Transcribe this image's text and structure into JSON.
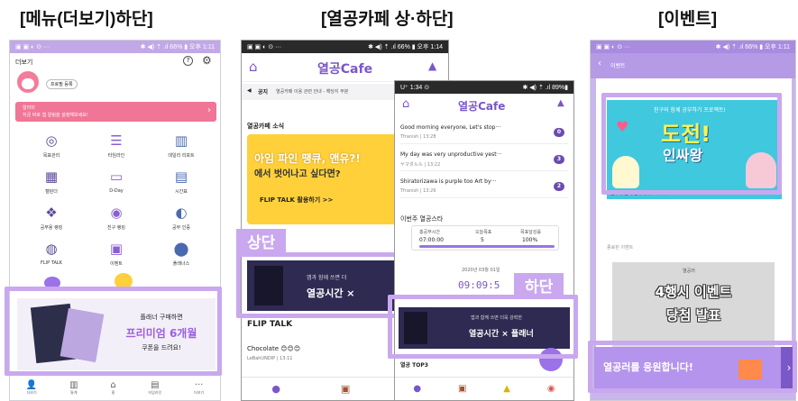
{
  "titles": [
    "[메뉴(더보기)하단]",
    "[열공카페 상·하단]",
    "[이벤트]"
  ],
  "tags": {
    "top": "상단",
    "bottom": "하단"
  },
  "p1": {
    "status_left": "▣ ▣ ◐ ⊙ ···",
    "status_right": "✱ ◀) ⇡ .ıl 66% ▮ 오후 1:11",
    "header": "더보기",
    "profile_btn": "프로필 등록",
    "notice_title": "알리미",
    "notice_text": "지금 바로 앱 알림을 설정해보세요!",
    "grid": [
      [
        "목표관리",
        "타임라인",
        "데일리 리포트"
      ],
      [
        "캘린더",
        "D-Day",
        "시간표"
      ],
      [
        "공부용 랭킹",
        "친구 랭킹",
        "공부 인증"
      ],
      [
        "FLIP TALK",
        "이벤트",
        "플래너스"
      ]
    ],
    "banner": [
      "플래너 구매하면",
      "프리미엄 6개월",
      "쿠폰을 드려요!"
    ],
    "nav": [
      "더보기",
      "통계",
      "홈",
      "타임라인",
      "더보기"
    ]
  },
  "p2": {
    "status_left": "▣ ▣ ◐ ⊙ ···",
    "status_right": "✱ ◀) ⇡ .ıl 66% ▮ 오후 1:14",
    "logo": "열공Cafe",
    "notice_label": "공지",
    "notice_text": "열공카페 이용 관련 안내 - 해당지 부분",
    "section": "열공카페 소식",
    "hero": [
      "아임 파인 땡큐, 앤유?!",
      "에서 벗어나고 싶다면?"
    ],
    "hero_link": "FLIP TALK 활용하기 >>",
    "ad": [
      "앱과 함께 쓰면 더",
      "열공시간 ×"
    ],
    "flip_title": "FLIP TALK",
    "post_title": "Chocolate 😊😊😊",
    "post_meta": "LeBahUNDIP | 13:11"
  },
  "p3": {
    "status_left": "U⁺ 1:34 ⊙",
    "status_right": "✱ ◀) ⇡ .ıl 89%▮",
    "logo": "열공Cafe",
    "posts": [
      [
        "Good morning everyone, Let's stop···",
        "Tfranish | 13:28",
        "0"
      ],
      [
        "My day was very unproductive yest···",
        "ヤマダルル | 13:22",
        "3"
      ],
      [
        "Shiratorizawa is purple too Art by···",
        "Tfranish | 13:26",
        "2"
      ]
    ],
    "star_title": "이번주 열공스타",
    "stat_labels": [
      "총공부시간",
      "오늘목표",
      "목표달성률"
    ],
    "stat_values": [
      "07:00:00",
      "5",
      "100%"
    ],
    "date": "2020년 03월 01일",
    "timer": "09:09:5",
    "ad": [
      "앱과 함께 쓰면 더욱 강력한",
      "열공시간 × 플래너"
    ],
    "top3": "열공 TOP3"
  },
  "p4": {
    "status_left": "▣ ▣ ◐ ⊙ ···",
    "status_right": "✱ ◀) ⇡ .ıl 66% ▮ 오후 1:11",
    "header": "이벤트",
    "ev1_small": "친구와 함께 공부하기 프로젝트!",
    "ev1_big": [
      "도전!",
      "인싸왕"
    ],
    "ev1_desc": "친구와 함께 공부하기 프로젝트!",
    "ended": "종료된 이벤트",
    "ev2_small": "열공러",
    "ev2": [
      "4행시 이벤트",
      "당첨 발표"
    ],
    "cheer": "열공러를 응원합니다!"
  },
  "colors": {
    "purple": "#9b72e8",
    "highlight": "#c9a8ef",
    "dark": "#2e2a52"
  }
}
